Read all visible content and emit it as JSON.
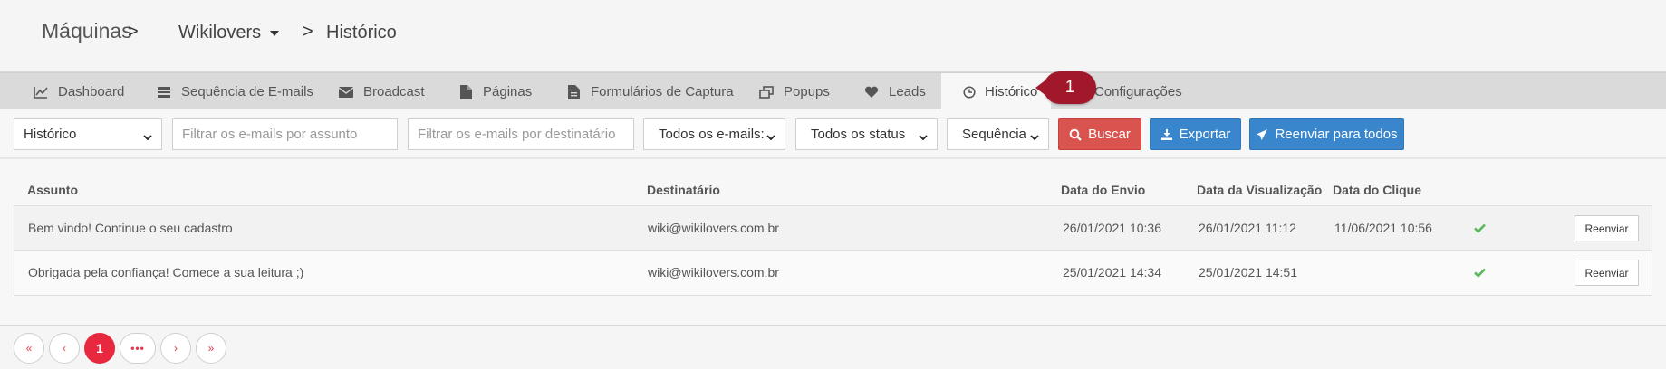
{
  "breadcrumb": {
    "root": "Máquinas",
    "separator": ">",
    "machine": "Wikilovers",
    "current": "Histórico"
  },
  "tabs": [
    {
      "label": "Dashboard",
      "icon": "line-chart-icon"
    },
    {
      "label": "Sequência de E-mails",
      "icon": "list-icon"
    },
    {
      "label": "Broadcast",
      "icon": "envelope-icon"
    },
    {
      "label": "Páginas",
      "icon": "file-icon"
    },
    {
      "label": "Formulários de Captura",
      "icon": "file-text-icon"
    },
    {
      "label": "Popups",
      "icon": "window-restore-icon"
    },
    {
      "label": "Leads",
      "icon": "heart-icon"
    },
    {
      "label": "Histórico",
      "icon": "clock-icon",
      "active": true
    },
    {
      "label": "Configurações"
    }
  ],
  "callout": {
    "label": "1",
    "color": "#a2182b"
  },
  "filters": {
    "type_select": "Histórico",
    "subject_placeholder": "Filtrar os e-mails por assunto",
    "recipient_placeholder": "Filtrar os e-mails por destinatário",
    "emails_select": "Todos os e-mails:",
    "status_select": "Todos os status",
    "sequence_select": "Sequência",
    "search_button": "Buscar",
    "export_button": "Exportar",
    "resend_all_button": "Reenviar para todos"
  },
  "table": {
    "headers": [
      "Assunto",
      "Destinatário",
      "Data do Envio",
      "Data da Visualização",
      "Data do Clique"
    ],
    "rows": [
      {
        "subject": "Bem vindo! Continue o seu cadastro",
        "recipient": "wiki@wikilovers.com.br",
        "sent": "26/01/2021 10:36",
        "viewed": "26/01/2021 11:12",
        "clicked": "11/06/2021 10:56",
        "action": "Reenviar"
      },
      {
        "subject": "Obrigada pela confiança! Comece a sua leitura ;)",
        "recipient": "wiki@wikilovers.com.br",
        "sent": "25/01/2021 14:34",
        "viewed": "25/01/2021 14:51",
        "clicked": "",
        "action": "Reenviar"
      }
    ]
  },
  "pagination": {
    "first": "«",
    "prev": "‹",
    "current": "1",
    "more": "•••",
    "next": "›",
    "last": "»"
  },
  "colors": {
    "danger": "#d9534f",
    "primary": "#3a86cc",
    "success": "#5cb85c",
    "page_active": "#e8283e"
  }
}
